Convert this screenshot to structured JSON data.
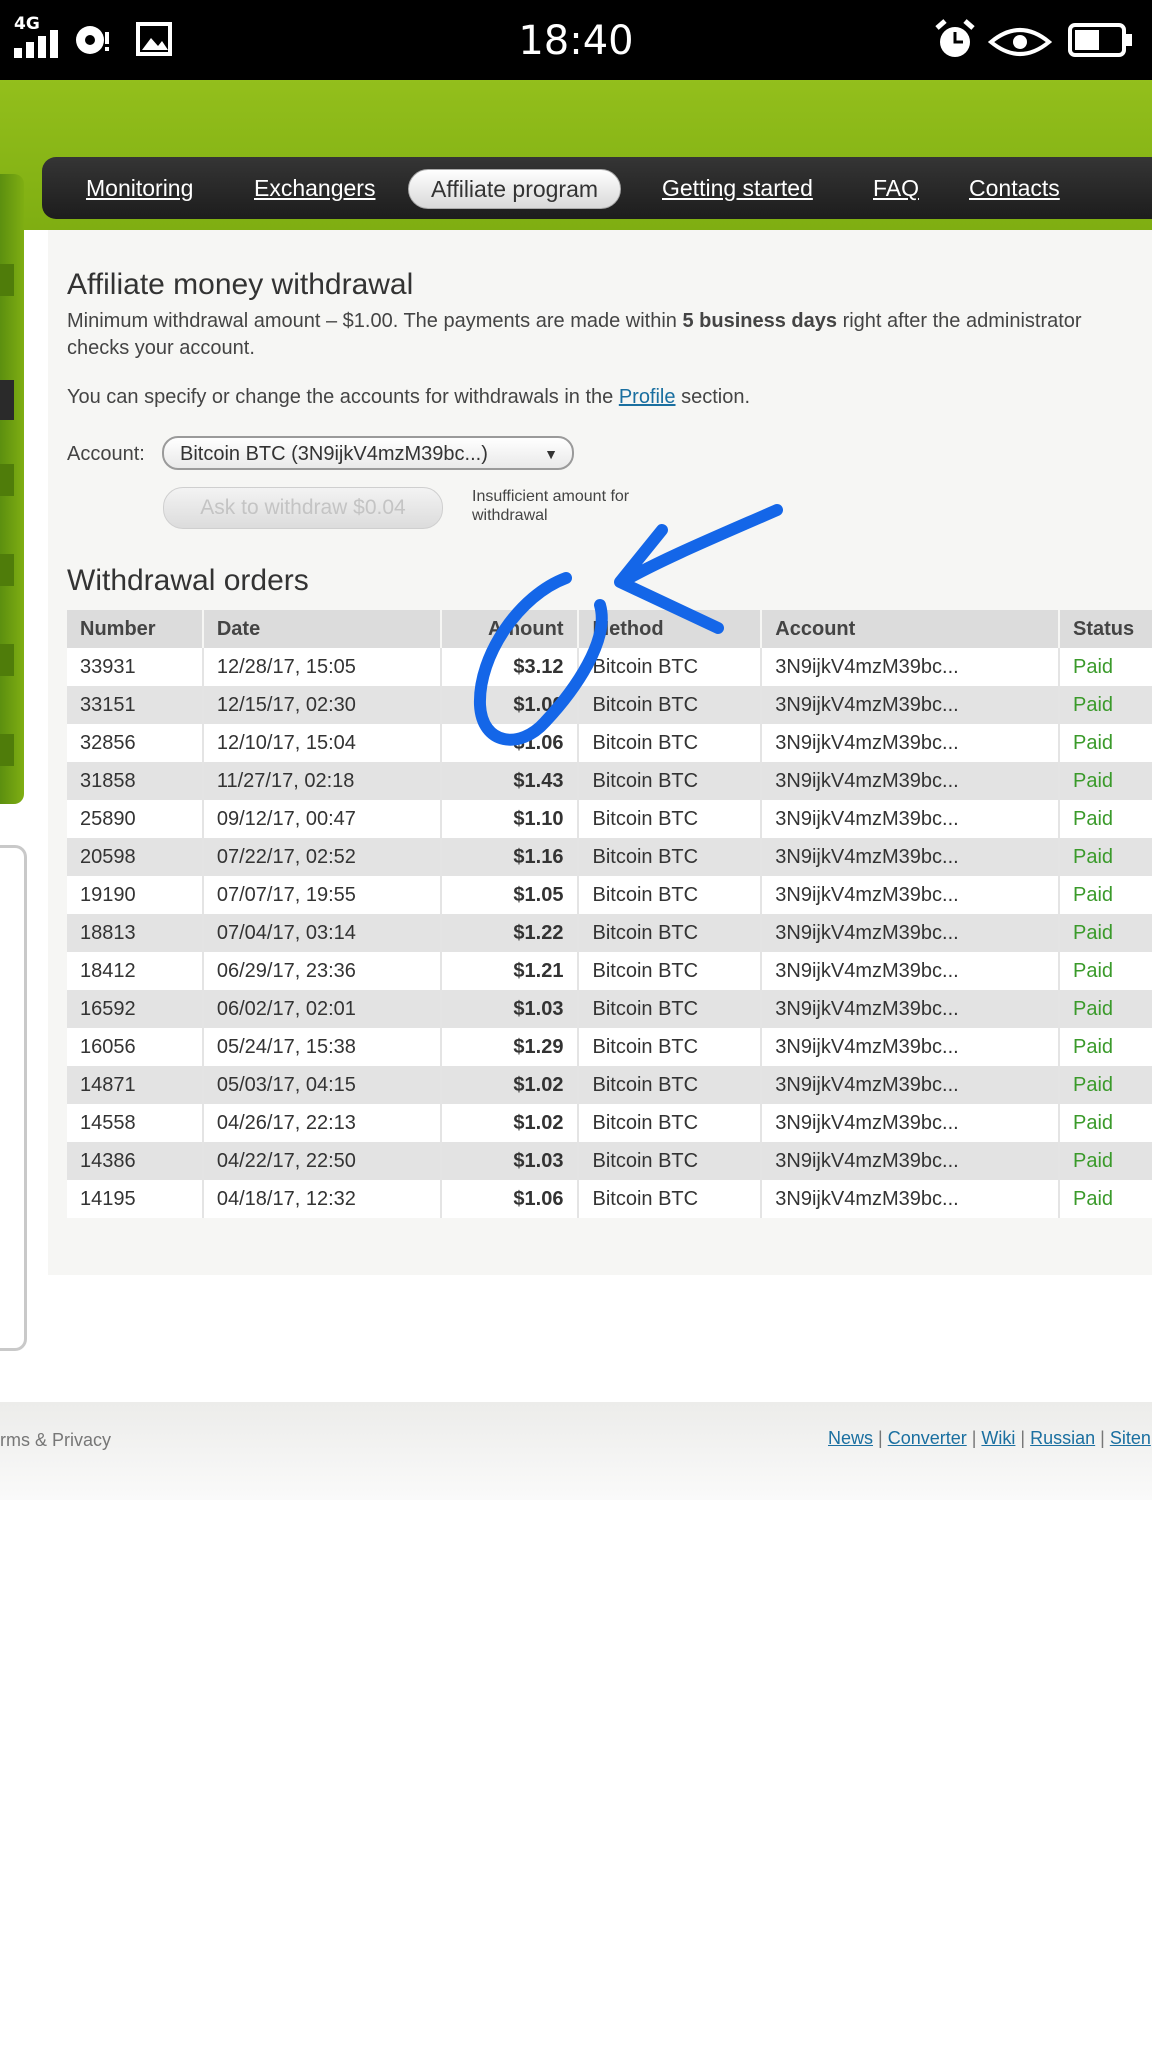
{
  "status_bar": {
    "network": "4G",
    "time": "18:40",
    "icons": [
      "signal-icon",
      "hotspot-icon",
      "image-icon",
      "alarm-icon",
      "eye-icon",
      "battery-icon"
    ]
  },
  "nav": {
    "items": [
      {
        "label": "Monitoring"
      },
      {
        "label": "Exchangers"
      },
      {
        "label": "Affiliate program",
        "active": true
      },
      {
        "label": "Getting started"
      },
      {
        "label": "FAQ"
      },
      {
        "label": "Contacts"
      }
    ]
  },
  "withdrawal": {
    "title": "Affiliate money withdrawal",
    "min_text_a": "Minimum withdrawal amount – $1.00. The payments are made within ",
    "min_text_bold": "5 business days",
    "min_text_b": " right after the administrator checks your account.",
    "accounts_text_a": "You can specify or change the accounts for withdrawals in the ",
    "profile_link": "Profile",
    "accounts_text_b": " section.",
    "account_label": "Account:",
    "account_value": "Bitcoin BTC (3N9ijkV4mzM39bc...)",
    "button_label": "Ask to withdraw $0.04",
    "insufficient_note": "Insufficient amount for withdrawal"
  },
  "orders": {
    "title": "Withdrawal orders",
    "columns": [
      "Number",
      "Date",
      "Amount",
      "Method",
      "Account",
      "Status"
    ],
    "rows": [
      [
        "33931",
        "12/28/17, 15:05",
        "$3.12",
        "Bitcoin BTC",
        "3N9ijkV4mzM39bc...",
        "Paid"
      ],
      [
        "33151",
        "12/15/17, 02:30",
        "$1.00",
        "Bitcoin BTC",
        "3N9ijkV4mzM39bc...",
        "Paid"
      ],
      [
        "32856",
        "12/10/17, 15:04",
        "$1.06",
        "Bitcoin BTC",
        "3N9ijkV4mzM39bc...",
        "Paid"
      ],
      [
        "31858",
        "11/27/17, 02:18",
        "$1.43",
        "Bitcoin BTC",
        "3N9ijkV4mzM39bc...",
        "Paid"
      ],
      [
        "25890",
        "09/12/17, 00:47",
        "$1.10",
        "Bitcoin BTC",
        "3N9ijkV4mzM39bc...",
        "Paid"
      ],
      [
        "20598",
        "07/22/17, 02:52",
        "$1.16",
        "Bitcoin BTC",
        "3N9ijkV4mzM39bc...",
        "Paid"
      ],
      [
        "19190",
        "07/07/17, 19:55",
        "$1.05",
        "Bitcoin BTC",
        "3N9ijkV4mzM39bc...",
        "Paid"
      ],
      [
        "18813",
        "07/04/17, 03:14",
        "$1.22",
        "Bitcoin BTC",
        "3N9ijkV4mzM39bc...",
        "Paid"
      ],
      [
        "18412",
        "06/29/17, 23:36",
        "$1.21",
        "Bitcoin BTC",
        "3N9ijkV4mzM39bc...",
        "Paid"
      ],
      [
        "16592",
        "06/02/17, 02:01",
        "$1.03",
        "Bitcoin BTC",
        "3N9ijkV4mzM39bc...",
        "Paid"
      ],
      [
        "16056",
        "05/24/17, 15:38",
        "$1.29",
        "Bitcoin BTC",
        "3N9ijkV4mzM39bc...",
        "Paid"
      ],
      [
        "14871",
        "05/03/17, 04:15",
        "$1.02",
        "Bitcoin BTC",
        "3N9ijkV4mzM39bc...",
        "Paid"
      ],
      [
        "14558",
        "04/26/17, 22:13",
        "$1.02",
        "Bitcoin BTC",
        "3N9ijkV4mzM39bc...",
        "Paid"
      ],
      [
        "14386",
        "04/22/17, 22:50",
        "$1.03",
        "Bitcoin BTC",
        "3N9ijkV4mzM39bc...",
        "Paid"
      ],
      [
        "14195",
        "04/18/17, 12:32",
        "$1.06",
        "Bitcoin BTC",
        "3N9ijkV4mzM39bc...",
        "Paid"
      ]
    ]
  },
  "footer": {
    "terms": "rms & Privacy",
    "links": [
      "News",
      "Converter",
      "Wiki",
      "Russian",
      "Siten"
    ]
  },
  "colors": {
    "brand_green": "#8cb81a",
    "nav_dark": "#2a2a2a",
    "link_blue": "#1a6fa0",
    "paid_green": "#3a9a2a",
    "annotation_blue": "#1466e8"
  }
}
